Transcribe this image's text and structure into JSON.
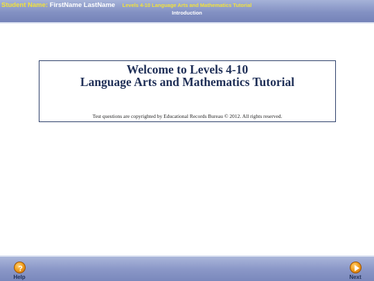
{
  "header": {
    "student_label": "Student Name:",
    "student_name": "FirstName LastName",
    "app_title": "Levels 4-10 Language Arts and Mathematics Tutorial",
    "section": "Introduction"
  },
  "welcome": {
    "line1": "Welcome to Levels 4-10",
    "line2": "Language Arts and Mathematics Tutorial",
    "copyright": "Test questions are copyrighted by Educational Records Bureau © 2012. All rights reserved."
  },
  "footer": {
    "help_label": "Help",
    "help_icon": "question-mark-icon",
    "next_label": "Next",
    "next_icon": "arrow-right-icon"
  },
  "colors": {
    "header_accent": "#f3e23a",
    "bar_blue": "#8391c3",
    "title_navy": "#1f2f57",
    "button_orange": "#f3a11f"
  }
}
